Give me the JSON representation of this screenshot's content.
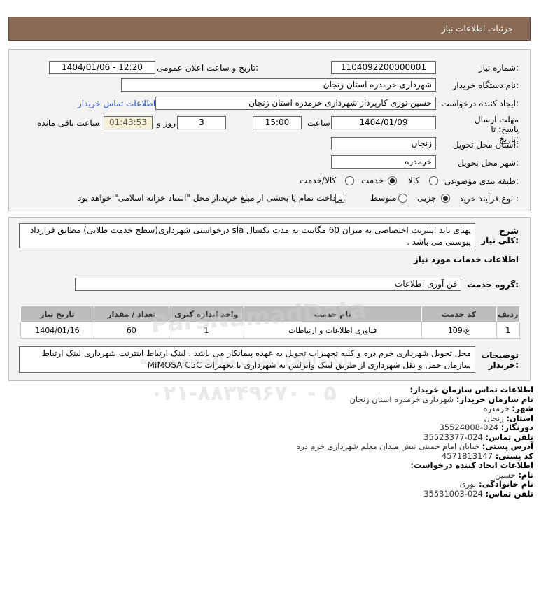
{
  "header": {
    "title": "جزئیات اطلاعات نیاز"
  },
  "form": {
    "need_number": {
      "label": "شماره نیاز:",
      "value": "1104092200000001"
    },
    "announce": {
      "label": "تاریخ و ساعت اعلان عمومی:",
      "value": "1404/01/06 - 12:20"
    },
    "buyer": {
      "label": "نام دستگاه خریدار:",
      "value": "شهرداری خرمدره استان زنجان"
    },
    "creator": {
      "label": "ایجاد کننده درخواست:",
      "value": "حسین نوری کارپرداز شهرداری خرمدره استان زنجان",
      "contact_link": "اطلاعات تماس خریدار"
    },
    "deadline": {
      "label": "مهلت ارسال پاسخ: تا تاریخ:",
      "date": "1404/01/09",
      "time_label": "ساعت",
      "time": "15:00",
      "days": "3",
      "days_label": "روز و",
      "remaining": "01:43:53",
      "remaining_label": "ساعت باقی مانده"
    },
    "province": {
      "label": "استان محل تحویل:",
      "value": "زنجان"
    },
    "city": {
      "label": "شهر محل تحویل:",
      "value": "خرمدره"
    },
    "category": {
      "label": "طبقه بندی موضوعی:",
      "options": [
        "کالا",
        "خدمت",
        "کالا/خدمت"
      ],
      "selected": "خدمت"
    },
    "purchase_type": {
      "label": "نوع فرآیند خرید :",
      "options": [
        "جزیی",
        "متوسط"
      ],
      "selected": "جزیی",
      "treasury_note": "پرداخت تمام یا بخشی از مبلغ خرید،از محل \"اسناد خزانه اسلامی\" خواهد بود."
    }
  },
  "summary": {
    "label": "شرح کلی نیاز:",
    "text": "پهنای باند اینترنت اختصاصی به میزان 60 مگابیت به مدت یکسال sla درخواستی شهرداری(سطح خدمت طلایی) مطابق قرارداد پیوستی می باشد ."
  },
  "services": {
    "section_title": "اطلاعات خدمات مورد نیاز",
    "group_label": "گروه خدمت:",
    "group_value": "فن آوری اطلاعات",
    "table": {
      "headers": [
        "ردیف",
        "کد خدمت",
        "نام خدمت",
        "واحد اندازه گیری",
        "تعداد / مقدار",
        "تاریخ نیاز"
      ],
      "rows": [
        [
          "1",
          "غ-109",
          "فناوری اطلاعات و ارتباطات",
          "1",
          "60",
          "1404/01/16"
        ]
      ]
    }
  },
  "buyer_notes": {
    "label": "توضیحات خریدار:",
    "text": "محل تحویل شهرداری خرم دره و کلیه تجهیزات تحویل به عهده پیمانکار می باشد . لینک ارتباط اینترنت شهرداری لینک ارتباط سازمان حمل و نقل شهرداری از طریق لینک وایرلس به شهرداری با تجهیزات MIMOSA C5C"
  },
  "contact": {
    "title": "اطلاعات تماس سازمان خریدار:",
    "rows": [
      {
        "k": "نام سازمان خریدار:",
        "v": "شهرداری خرمدره استان زنجان"
      },
      {
        "k": "شهر:",
        "v": "خرمدره"
      },
      {
        "k": "استان:",
        "v": "زنجان"
      },
      {
        "k": "دورنگار:",
        "v": "024-35524008"
      },
      {
        "k": "تلفن تماس:",
        "v": "024-35523377"
      },
      {
        "k": "آدرس پستی:",
        "v": "خیابان امام خمینی نبش میدان معلم شهرداری خرم دره"
      },
      {
        "k": "کد پستی:",
        "v": "4571813147"
      }
    ],
    "creator_title": "اطلاعات ایجاد کننده درخواست:",
    "creator_rows": [
      {
        "k": "نام:",
        "v": "حسین"
      },
      {
        "k": "نام خانوادگی:",
        "v": "نوری"
      },
      {
        "k": "تلفن تماس:",
        "v": "024-35531003"
      }
    ]
  },
  "watermark": {
    "brand": "ParsNamadData",
    "tagline": "پایگاه اطلاع رسانی مناقصه و مزایده",
    "phone": "۰۲۱-۸۸۳۴۹۶۷۰ - ۵"
  }
}
